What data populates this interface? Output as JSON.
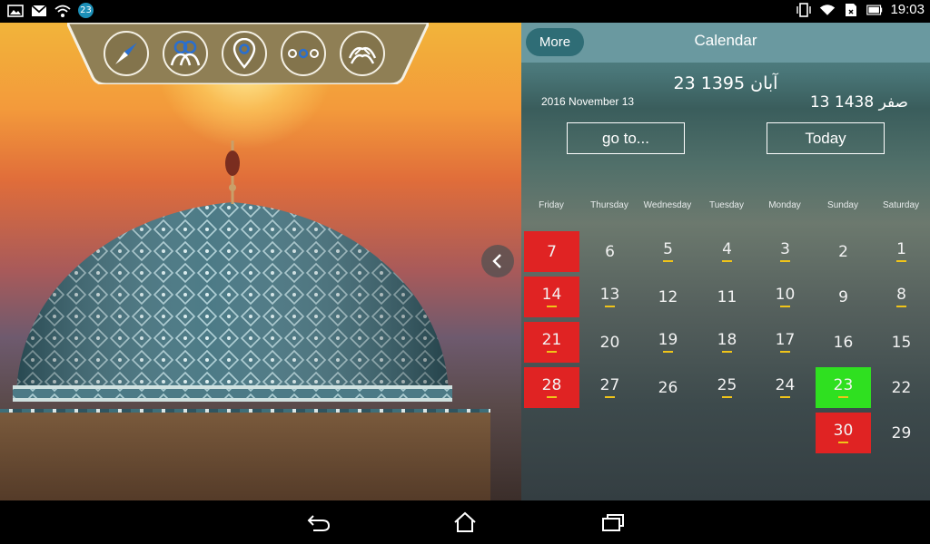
{
  "status_bar": {
    "notification_count": "23",
    "time": "19:03"
  },
  "tray": {
    "icons": [
      "compass-icon",
      "people-icon",
      "location-pin-icon",
      "more-dots-icon",
      "praying-hands-icon"
    ]
  },
  "calendar": {
    "more_label": "More",
    "title": "Calendar",
    "persian_date": "23 آبان 1395",
    "gregorian_date": "2016 November 13",
    "hijri_date": "13 صفر 1438",
    "goto_label": "go to...",
    "today_label": "Today",
    "weekdays": [
      "Friday",
      "Thursday",
      "Wednesday",
      "Tuesday",
      "Monday",
      "Sunday",
      "Saturday"
    ],
    "rows": [
      [
        {
          "n": "7",
          "state": "holiday",
          "dash": false
        },
        {
          "n": "6",
          "state": "",
          "dash": false
        },
        {
          "n": "5",
          "state": "",
          "dash": true
        },
        {
          "n": "4",
          "state": "",
          "dash": true
        },
        {
          "n": "3",
          "state": "",
          "dash": true
        },
        {
          "n": "2",
          "state": "",
          "dash": false
        },
        {
          "n": "1",
          "state": "",
          "dash": true
        }
      ],
      [
        {
          "n": "14",
          "state": "holiday",
          "dash": true
        },
        {
          "n": "13",
          "state": "",
          "dash": true
        },
        {
          "n": "12",
          "state": "",
          "dash": false
        },
        {
          "n": "11",
          "state": "",
          "dash": false
        },
        {
          "n": "10",
          "state": "",
          "dash": true
        },
        {
          "n": "9",
          "state": "",
          "dash": false
        },
        {
          "n": "8",
          "state": "",
          "dash": true
        }
      ],
      [
        {
          "n": "21",
          "state": "holiday",
          "dash": true
        },
        {
          "n": "20",
          "state": "",
          "dash": false
        },
        {
          "n": "19",
          "state": "",
          "dash": true
        },
        {
          "n": "18",
          "state": "",
          "dash": true
        },
        {
          "n": "17",
          "state": "",
          "dash": true
        },
        {
          "n": "16",
          "state": "",
          "dash": false
        },
        {
          "n": "15",
          "state": "",
          "dash": false
        }
      ],
      [
        {
          "n": "28",
          "state": "holiday",
          "dash": true
        },
        {
          "n": "27",
          "state": "",
          "dash": true
        },
        {
          "n": "26",
          "state": "",
          "dash": false
        },
        {
          "n": "25",
          "state": "",
          "dash": true
        },
        {
          "n": "24",
          "state": "",
          "dash": true
        },
        {
          "n": "23",
          "state": "today",
          "dash": true
        },
        {
          "n": "22",
          "state": "",
          "dash": false
        }
      ],
      [
        {
          "n": "",
          "state": "empty",
          "dash": false
        },
        {
          "n": "",
          "state": "empty",
          "dash": false
        },
        {
          "n": "",
          "state": "empty",
          "dash": false
        },
        {
          "n": "",
          "state": "empty",
          "dash": false
        },
        {
          "n": "",
          "state": "empty",
          "dash": false
        },
        {
          "n": "30",
          "state": "holiday",
          "dash": true
        },
        {
          "n": "29",
          "state": "",
          "dash": false
        }
      ]
    ]
  },
  "colors": {
    "holiday": "#e02323",
    "today": "#2fe020",
    "dash": "#f0c419",
    "header": "#6a99a0",
    "more_button": "#2f6d76"
  }
}
